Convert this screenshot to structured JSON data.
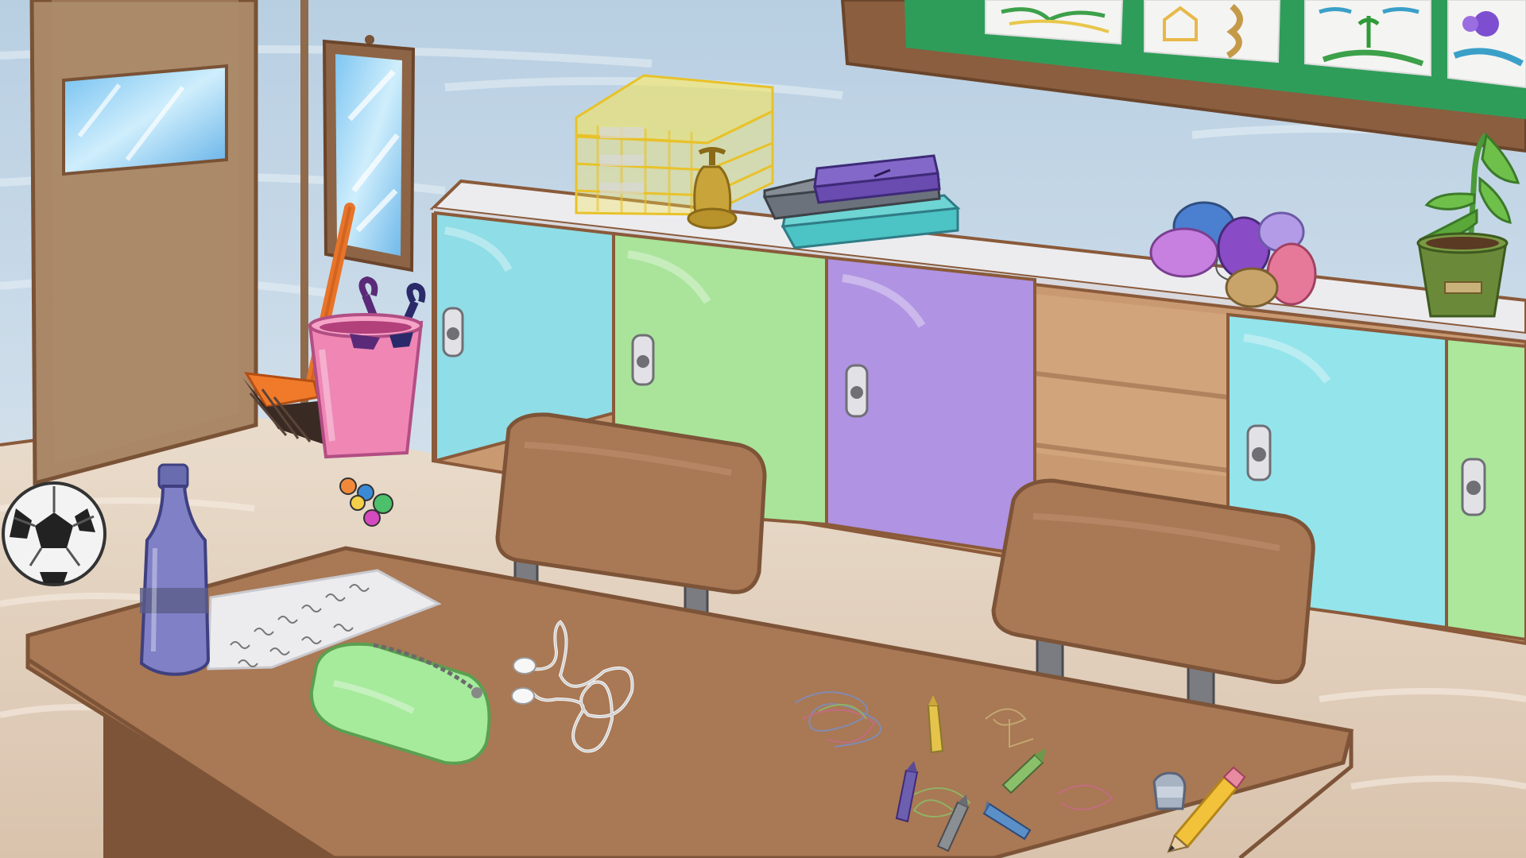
{
  "scene": {
    "name": "classroom",
    "palette": {
      "wall": "#c7d8e6",
      "floor": "#e6d6c4",
      "outline": "#8a5a3a",
      "wood": "#a97854",
      "wood_dark": "#7d5438",
      "door": "#a88466",
      "cyan_locker": "#8fdde6",
      "green_locker": "#a9e49a",
      "purple_locker": "#b093e2",
      "counter_top": "#ececef",
      "bottle": "#7f80c6",
      "pouch": "#a6ea9c",
      "bucket": "#ef86b4",
      "tray": "#f4e04a",
      "board": "#2f9d5a"
    }
  },
  "lockers": [
    {
      "id": "cyan-1",
      "color": "#8fdde6"
    },
    {
      "id": "green-1",
      "color": "#a9e49a"
    },
    {
      "id": "purple-1",
      "color": "#b093e2"
    },
    {
      "id": "cyan-2",
      "color": "#94e4ec"
    },
    {
      "id": "green-2",
      "color": "#ace79c"
    }
  ],
  "balloons": [
    {
      "color": "#4b7fd0"
    },
    {
      "color": "#c77fe0"
    },
    {
      "color": "#8a4bc7"
    },
    {
      "color": "#b49be8"
    },
    {
      "color": "#e6799a"
    },
    {
      "color": "#c9a46a"
    }
  ],
  "crayons": [
    {
      "color": "#e6c34a"
    },
    {
      "color": "#8ac06a"
    },
    {
      "color": "#6d5fb0"
    },
    {
      "color": "#8a8f94"
    },
    {
      "color": "#5a8fc7"
    }
  ],
  "marbles": [
    {
      "color": "#f08a3a"
    },
    {
      "color": "#3a8ad6"
    },
    {
      "color": "#4cc06a"
    },
    {
      "color": "#d64ac0"
    },
    {
      "color": "#f4d04a"
    }
  ]
}
